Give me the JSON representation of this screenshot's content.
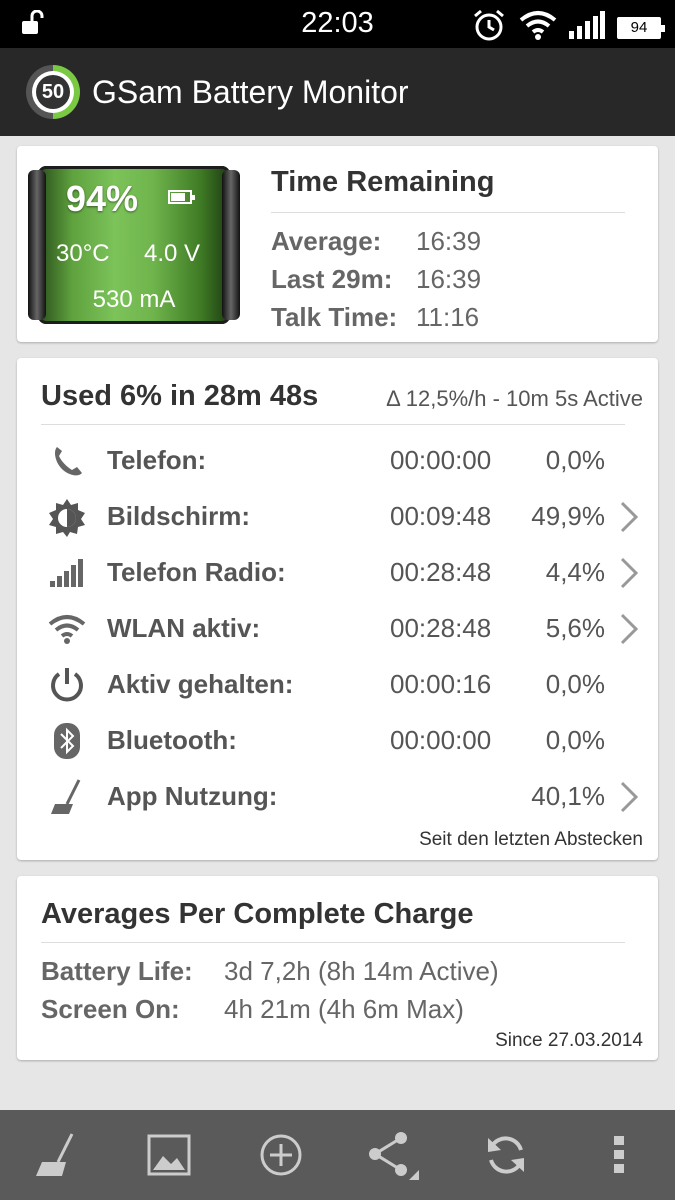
{
  "status_bar": {
    "time": "22:03",
    "battery_level": "94"
  },
  "action_bar": {
    "logo_text": "50",
    "title": "GSam Battery Monitor"
  },
  "battery_card": {
    "percent": "94%",
    "temperature": "30°C",
    "voltage": "4.0 V",
    "current": "530 mA",
    "time_remaining_title": "Time Remaining",
    "rows": [
      {
        "label": "Average:",
        "value": "16:39"
      },
      {
        "label": "Last 29m:",
        "value": "16:39"
      },
      {
        "label": "Talk Time:",
        "value": "11:16"
      }
    ]
  },
  "usage_card": {
    "title": "Used 6% in 28m 48s",
    "delta": "Δ 12,5%/h - 10m 5s Active",
    "rows": [
      {
        "icon": "phone-icon",
        "name": "Telefon:",
        "time": "00:00:00",
        "percent": "0,0%",
        "has_chevron": false
      },
      {
        "icon": "brightness-icon",
        "name": "Bildschirm:",
        "time": "00:09:48",
        "percent": "49,9%",
        "has_chevron": true
      },
      {
        "icon": "signal-icon",
        "name": "Telefon Radio:",
        "time": "00:28:48",
        "percent": "4,4%",
        "has_chevron": true
      },
      {
        "icon": "wifi-icon",
        "name": "WLAN aktiv:",
        "time": "00:28:48",
        "percent": "5,6%",
        "has_chevron": true
      },
      {
        "icon": "power-icon",
        "name": "Aktiv gehalten:",
        "time": "00:00:16",
        "percent": "0,0%",
        "has_chevron": false
      },
      {
        "icon": "bluetooth-icon",
        "name": "Bluetooth:",
        "time": "00:00:00",
        "percent": "0,0%",
        "has_chevron": false
      },
      {
        "icon": "broom-icon",
        "name": "App Nutzung:",
        "time": "",
        "percent": "40,1%",
        "has_chevron": true
      }
    ],
    "footer": "Seit den letzten Abstecken"
  },
  "averages_card": {
    "title": "Averages Per Complete Charge",
    "rows": [
      {
        "label": "Battery Life:",
        "value": "3d 7,2h (8h 14m Active)"
      },
      {
        "label": "Screen On:",
        "value": "4h 21m (4h 6m Max)"
      }
    ],
    "footer": "Since 27.03.2014"
  },
  "bottom_bar": {
    "buttons": [
      "broom-icon",
      "image-icon",
      "add-circle-icon",
      "share-icon",
      "refresh-icon",
      "overflow-menu-icon"
    ]
  }
}
